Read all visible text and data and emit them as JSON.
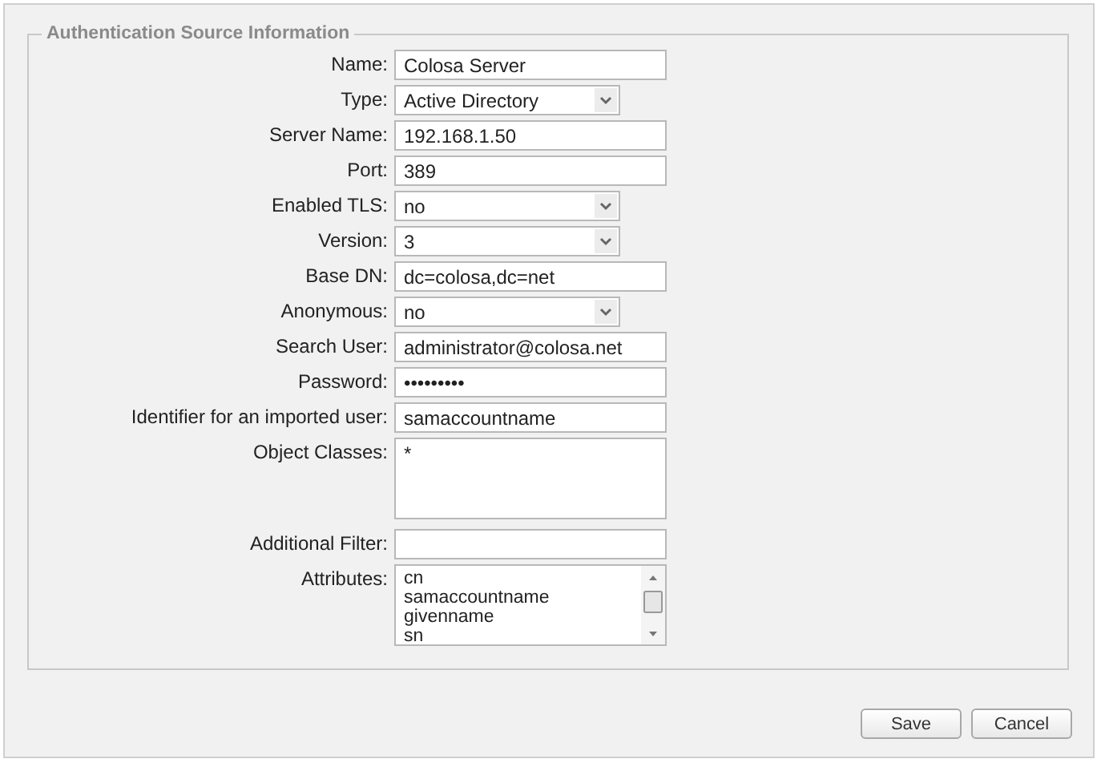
{
  "section": {
    "title": "Authentication Source Information"
  },
  "fields": [
    {
      "kind": "text",
      "label": "Name:",
      "value": "Colosa Server"
    },
    {
      "kind": "select",
      "label": "Type:",
      "value": "Active Directory"
    },
    {
      "kind": "text",
      "label": "Server Name:",
      "value": "192.168.1.50"
    },
    {
      "kind": "text",
      "label": "Port:",
      "value": "389"
    },
    {
      "kind": "select",
      "label": "Enabled TLS:",
      "value": "no"
    },
    {
      "kind": "select",
      "label": "Version:",
      "value": "3"
    },
    {
      "kind": "text",
      "label": "Base DN:",
      "value": "dc=colosa,dc=net"
    },
    {
      "kind": "select",
      "label": "Anonymous:",
      "value": "no"
    },
    {
      "kind": "text",
      "label": "Search User:",
      "value": "administrator@colosa.net"
    },
    {
      "kind": "password",
      "label": "Password:",
      "value": "•••••••••"
    },
    {
      "kind": "text",
      "label": "Identifier for an imported user:",
      "value": "samaccountname"
    },
    {
      "kind": "textarea",
      "label": "Object Classes:",
      "value": "*"
    },
    {
      "kind": "text",
      "label": "Additional Filter:"
    },
    {
      "kind": "listbox",
      "label": "Attributes:",
      "options": [
        "cn",
        "samaccountname",
        "givenname",
        "sn"
      ]
    }
  ],
  "buttons": [
    "Save",
    "Cancel"
  ]
}
